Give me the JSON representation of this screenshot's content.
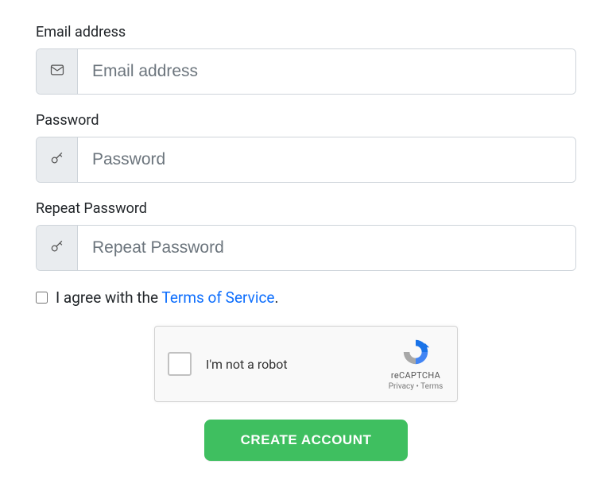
{
  "form": {
    "email": {
      "label": "Email address",
      "placeholder": "Email address",
      "value": ""
    },
    "password": {
      "label": "Password",
      "placeholder": "Password",
      "value": ""
    },
    "repeat_password": {
      "label": "Repeat Password",
      "placeholder": "Repeat Password",
      "value": ""
    },
    "agree": {
      "checked": false,
      "text_prefix": "I agree with the ",
      "link_text": "Terms of Service",
      "text_suffix": "."
    },
    "submit_label": "CREATE ACCOUNT"
  },
  "recaptcha": {
    "label": "I'm not a robot",
    "brand": "reCAPTCHA",
    "links": "Privacy • Terms"
  }
}
